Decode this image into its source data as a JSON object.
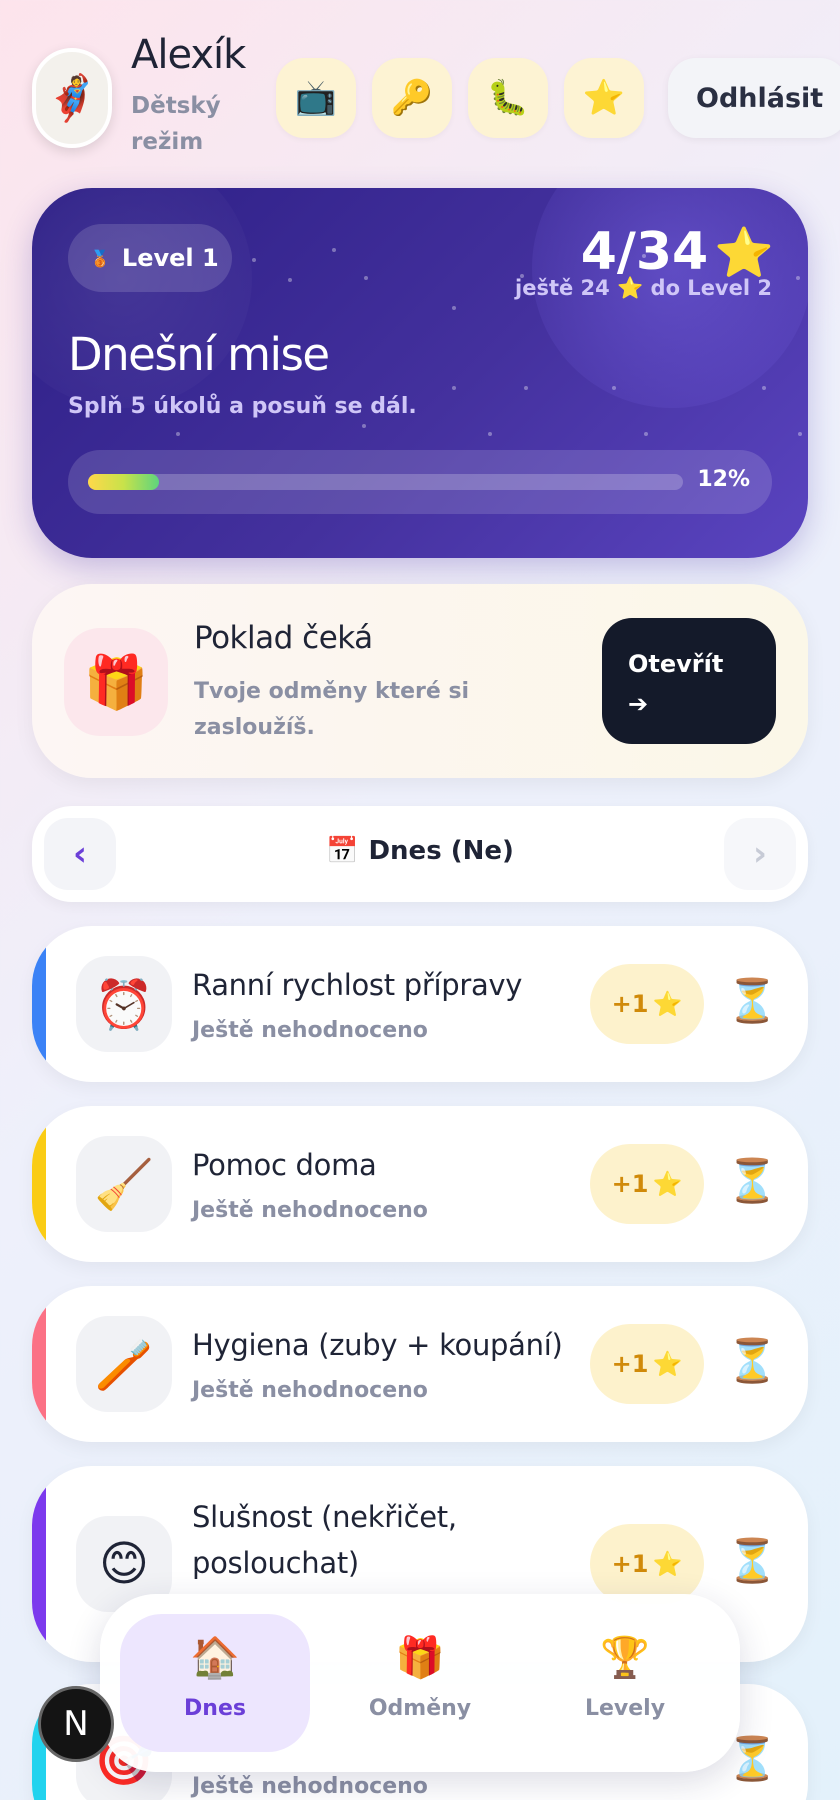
{
  "header": {
    "user_name": "Alexík",
    "mode": "Dětský režim",
    "avatar_icon": "🦸",
    "shortcuts": [
      {
        "name": "tv-icon",
        "glyph": "📺"
      },
      {
        "name": "key-icon",
        "glyph": "🔑"
      },
      {
        "name": "caterpillar-icon",
        "glyph": "🐛"
      },
      {
        "name": "star-icon",
        "glyph": "⭐"
      }
    ],
    "logout_label": "Odhlásit"
  },
  "mission": {
    "level_medal": "🥉",
    "level_label": "Level 1",
    "score": "4/34",
    "score_star": "⭐",
    "to_next": "ještě 24 ⭐ do Level 2",
    "title": "Dnešní mise",
    "subtitle": "Splň 5 úkolů a posuň se dál.",
    "progress_fraction": 0.12,
    "progress_label": "12%"
  },
  "treasure": {
    "icon": "🎁",
    "title": "Poklad čeká",
    "subtitle": "Tvoje odměny které si zasloužíš.",
    "button_label": "Otevřít",
    "button_arrow": "➔"
  },
  "date_nav": {
    "prev": "‹",
    "next": "›",
    "calendar_icon": "📅",
    "label": "Dnes (Ne)"
  },
  "tasks": [
    {
      "icon": "⏰",
      "name": "Ranní rychlost přípravy",
      "status": "Ještě nehodnoceno",
      "reward": "+1",
      "reward_star": "⭐",
      "state_icon": "⏳",
      "accent": "#3b82f6"
    },
    {
      "icon": "🧹",
      "name": "Pomoc doma",
      "status": "Ještě nehodnoceno",
      "reward": "+1",
      "reward_star": "⭐",
      "state_icon": "⏳",
      "accent": "#facc15"
    },
    {
      "icon": "🪥",
      "name": "Hygiena (zuby + koupání)",
      "status": "Ještě nehodnoceno",
      "reward": "+1",
      "reward_star": "⭐",
      "state_icon": "⏳",
      "accent": "#fb7185"
    },
    {
      "icon": "😊",
      "name": "Slušnost (nekřičet, poslouchat)",
      "status": "",
      "reward": "+1",
      "reward_star": "⭐",
      "state_icon": "⏳",
      "accent": "#7c3aed"
    },
    {
      "icon": "🎯",
      "name": "",
      "status": "Ještě nehodnoceno",
      "reward": "",
      "reward_star": "",
      "state_icon": "⏳",
      "accent": "#22d3ee"
    }
  ],
  "bottom_nav": [
    {
      "icon": "🏠",
      "label": "Dnes",
      "active": true
    },
    {
      "icon": "🎁",
      "label": "Odměny",
      "active": false
    },
    {
      "icon": "🏆",
      "label": "Levely",
      "active": false
    }
  ],
  "dev_badge": "N"
}
